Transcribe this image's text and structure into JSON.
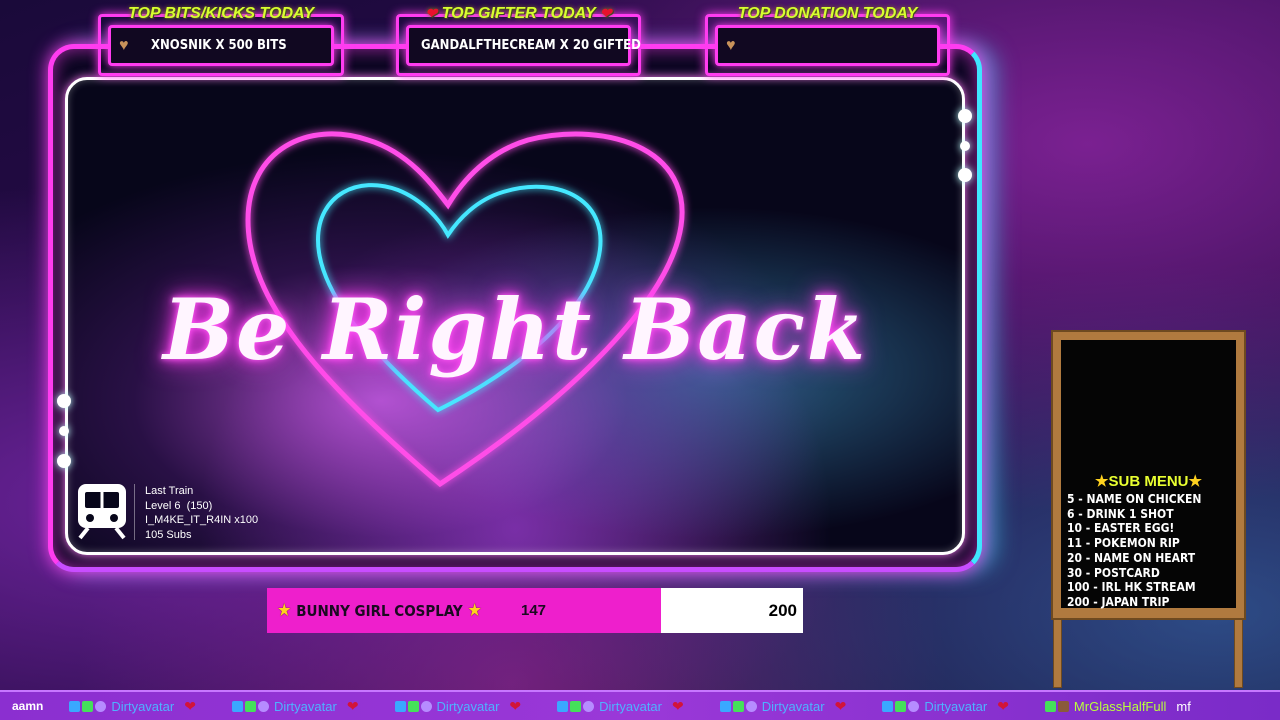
{
  "top_boxes": {
    "bits": {
      "title": "TOP BITS/KICKS TODAY",
      "icon": "heart-bronze-icon",
      "value": "XNOSNIK X 500 BITS"
    },
    "gifter": {
      "title": "TOP GIFTER TODAY",
      "icon": "heart-red-icon",
      "value": "GANDALFTHECREAM X 20 GIFTED"
    },
    "donation": {
      "title": "TOP DONATION TODAY",
      "icon": "heart-bronze-icon",
      "value": ""
    }
  },
  "scene": {
    "headline": "Be Right Back",
    "accent_pink": "#ff3cf0",
    "accent_cyan": "#3fe6ff"
  },
  "last_train": {
    "title": "Last Train",
    "level": "Level 6  (150)",
    "user": "I_M4KE_IT_R4IN x100",
    "subs": "105 Subs"
  },
  "goal": {
    "label": "BUNNY GIRL COSPLAY",
    "current": 147,
    "target": 200,
    "progress_fraction": 0.735,
    "fill_color": "#ee1fcc"
  },
  "sub_menu": {
    "title": "SUB MENU",
    "items": [
      "5 - NAME ON CHICKEN",
      "6 - DRINK 1 SHOT",
      "10 - EASTER EGG!",
      "11 - POKEMON RIP",
      "20 - NAME ON HEART",
      "30 - POSTCARD",
      "100 - IRL HK STREAM",
      "200 - JAPAN TRIP"
    ]
  },
  "ticker": {
    "lead": "aamn",
    "items": [
      {
        "name": "Dirtyavatar",
        "msg": "❤"
      },
      {
        "name": "Dirtyavatar",
        "msg": "❤"
      },
      {
        "name": "Dirtyavatar",
        "msg": "❤"
      },
      {
        "name": "Dirtyavatar",
        "msg": "❤"
      },
      {
        "name": "Dirtyavatar",
        "msg": "❤"
      },
      {
        "name": "Dirtyavatar",
        "msg": "❤"
      }
    ],
    "last_name": "MrGlassHalfFull",
    "tail": "mf"
  }
}
